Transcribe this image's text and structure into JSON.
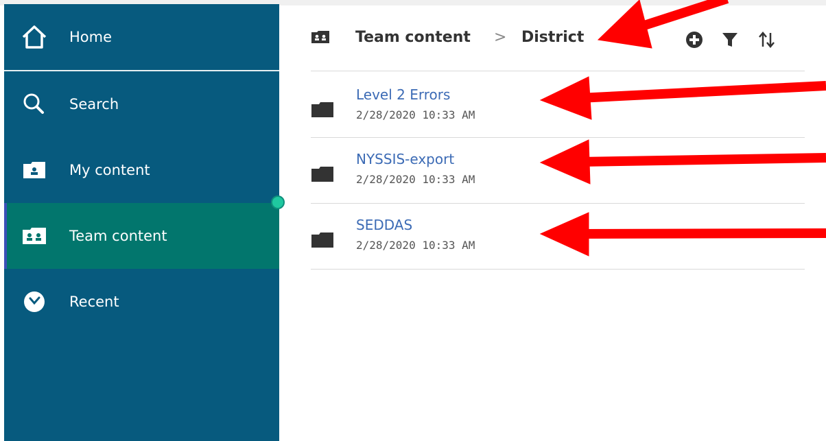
{
  "nav": {
    "home": "Home",
    "search": "Search",
    "my_content": "My content",
    "team_content": "Team content",
    "recent": "Recent"
  },
  "breadcrumb": {
    "root": "Team content",
    "separator": ">",
    "current": "District"
  },
  "items": [
    {
      "name": "Level 2 Errors",
      "modified": "2/28/2020 10:33 AM"
    },
    {
      "name": "NYSSIS-export",
      "modified": "2/28/2020 10:33 AM"
    },
    {
      "name": "SEDDAS",
      "modified": "2/28/2020 10:33 AM"
    }
  ],
  "colors": {
    "sidebar": "#075a7e",
    "active_nav": "#02766d",
    "link": "#3c6bb5",
    "annotation_arrow": "#ff0000"
  }
}
